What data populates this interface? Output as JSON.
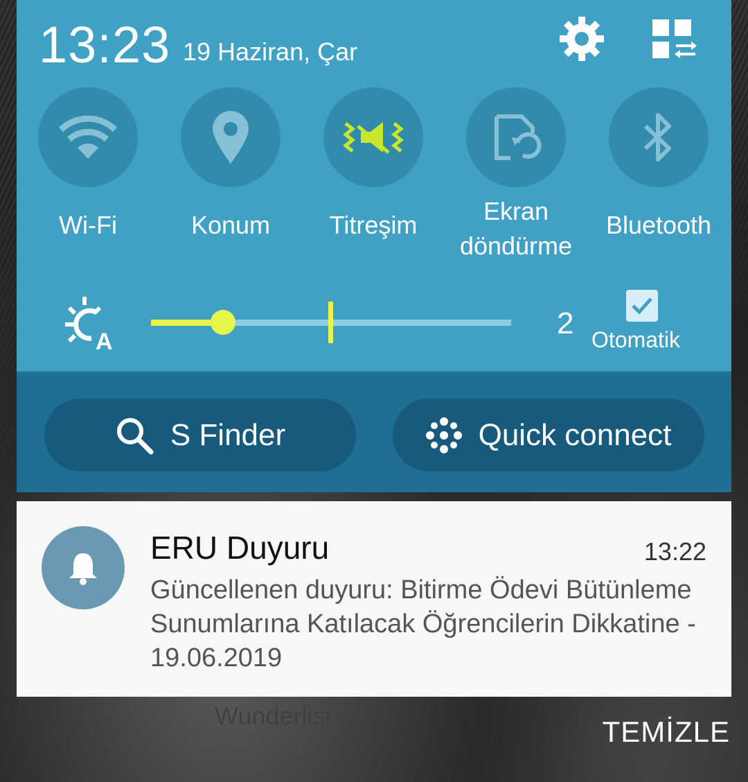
{
  "status": {
    "time": "13:23",
    "date": "19 Haziran, Çar"
  },
  "header_icons": {
    "settings": "gear-icon",
    "edit": "grid-edit-icon"
  },
  "toggles": [
    {
      "label_line1": "Wi-Fi",
      "label_line2": "",
      "icon": "wifi-icon",
      "active": false
    },
    {
      "label_line1": "Konum",
      "label_line2": "",
      "icon": "location-icon",
      "active": false
    },
    {
      "label_line1": "Titreşim",
      "label_line2": "",
      "icon": "vibrate-icon",
      "active": true
    },
    {
      "label_line1": "Ekran",
      "label_line2": "döndürme",
      "icon": "rotate-icon",
      "active": false
    },
    {
      "label_line1": "Bluetooth",
      "label_line2": "",
      "icon": "bluetooth-icon",
      "active": false
    }
  ],
  "brightness": {
    "value": "2",
    "level": 0.2,
    "auto_label": "Otomatik",
    "auto_checked": true
  },
  "buttons": {
    "sfinder": "S Finder",
    "quick_connect": "Quick connect"
  },
  "notification": {
    "app": "ERU Duyuru",
    "time": "13:22",
    "body": "Güncellenen duyuru: Bitirme Ödevi Bütünleme Sunumlarına Katılacak Öğrencilerin Dikkatine - 19.06.2019"
  },
  "background_text": "Wunderlist",
  "clear_label": "TEMİZLE",
  "colors": {
    "panel": "#40a1c5",
    "panel_dark": "#1f6e93",
    "accent": "#e8f54a"
  }
}
